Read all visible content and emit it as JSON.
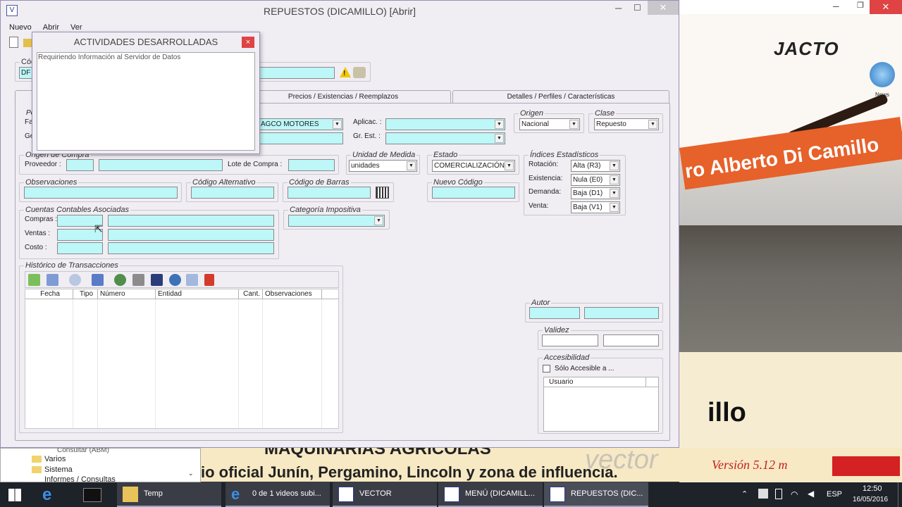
{
  "window": {
    "title": "REPUESTOS (DICAMILLO)  [Abrir]"
  },
  "menu": [
    "Nuevo",
    "Abrir",
    "Ver"
  ],
  "dialog": {
    "title": "ACTIVIDADES DESARROLLADAS",
    "message": "Requiriendo Información al Servidor de Datos",
    "close": "×"
  },
  "top": {
    "codigo_label": "Cód",
    "codigo_value": "DF"
  },
  "tabs": [
    "Precios / Existencias / Reemplazos",
    "Detalles / Perfiles / Características"
  ],
  "general": {
    "fa_label": "Fa",
    "ge_label": "Ge",
    "pe_label": "Pe",
    "marca_value": "AGCO MOTORES",
    "aplicac_label": "Aplicac. :",
    "grest_label": "Gr. Est. :"
  },
  "origen": {
    "title": "Origen",
    "value": "Nacional"
  },
  "clase": {
    "title": "Clase",
    "value": "Repuesto"
  },
  "origen_compra": {
    "title": "Origen de Compra",
    "proveedor_label": "Proveedor :",
    "lote_label": "Lote de Compra :"
  },
  "unidad": {
    "title": "Unidad de Medida",
    "value": "unidades"
  },
  "estado": {
    "title": "Estado",
    "value": "COMERCIALIZACIÓN"
  },
  "indices": {
    "title": "Índices Estadísticos",
    "rows": [
      {
        "label": "Rotación:",
        "value": "Alta (R3)"
      },
      {
        "label": "Existencia:",
        "value": "Nula (E0)"
      },
      {
        "label": "Demanda:",
        "value": "Baja (D1)"
      },
      {
        "label": "Venta:",
        "value": "Baja (V1)"
      }
    ]
  },
  "observaciones": {
    "title": "Observaciones"
  },
  "codigo_alternativo": {
    "title": "Código Alternativo"
  },
  "codigo_barras": {
    "title": "Código de Barras"
  },
  "nuevo_codigo": {
    "title": "Nuevo Código"
  },
  "cuentas": {
    "title": "Cuentas Contables Asociadas",
    "rows": [
      "Compras :",
      "Ventas :",
      "Costo :"
    ]
  },
  "categoria": {
    "title": "Categoría Impositiva"
  },
  "historico": {
    "title": "Histórico de Transacciones",
    "columns": [
      "Fecha",
      "Tipo",
      "Número",
      "Entidad",
      "Cant.",
      "Observaciones"
    ]
  },
  "autor": {
    "title": "Autor"
  },
  "validez": {
    "title": "Validez"
  },
  "accesibilidad": {
    "title": "Accesibilidad",
    "checkbox": "Sólo Accesible a ...",
    "column": "Usuario"
  },
  "background": {
    "brand": "JACTO",
    "news": "News",
    "sign": "ro Alberto Di Camillo",
    "camillo": "illo",
    "headline": "MAQUINARIAS AGRICOLAS",
    "subline": "io oficial Junín, Pergamino, Lincoln y zona de influencia.",
    "version": "Versión  5.12 m",
    "vector": "vector"
  },
  "tree": [
    "Consultar (ABM)",
    "Varios",
    "Sistema",
    "Informes / Consultas"
  ],
  "taskbar": {
    "items": [
      "Temp",
      "0 de 1 videos subi...",
      "VECTOR",
      "MENÚ (DICAMILL...",
      "REPUESTOS (DIC..."
    ],
    "lang": "ESP",
    "time": "12:50",
    "date": "16/05/2016"
  }
}
